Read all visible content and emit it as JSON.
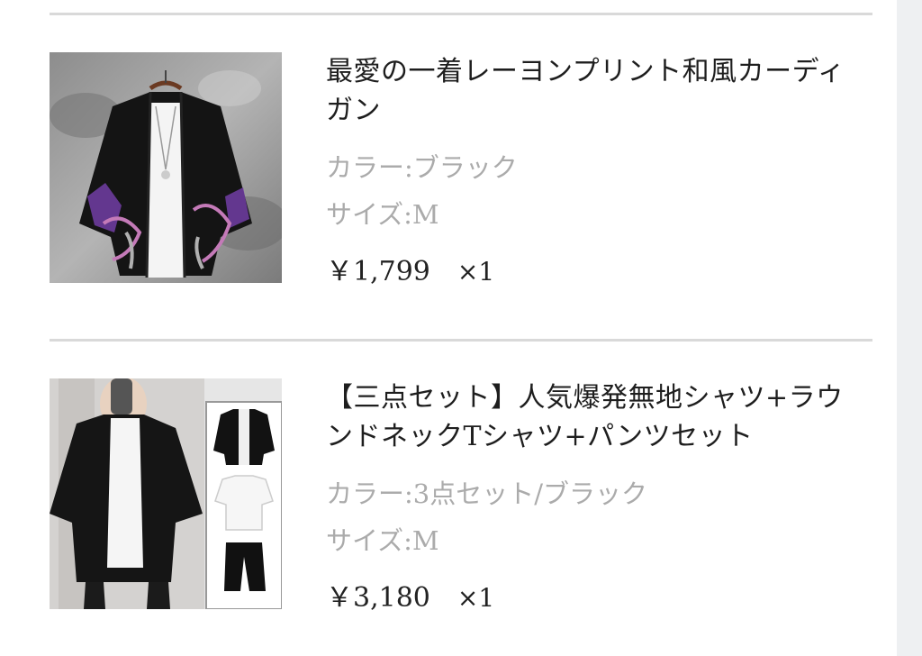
{
  "items": [
    {
      "title": "最愛の一着レーヨンプリント和風カーディガン",
      "color_label": "カラー:ブラック",
      "size_label": "サイズ:M",
      "price": "￥1,799",
      "quantity": "×1"
    },
    {
      "title": "【三点セット】人気爆発無地シャツ+ラウンドネックTシャツ+パンツセット",
      "color_label": "カラー:3点セット/ブラック",
      "size_label": "サイズ:M",
      "price": "￥3,180",
      "quantity": "×1"
    }
  ]
}
